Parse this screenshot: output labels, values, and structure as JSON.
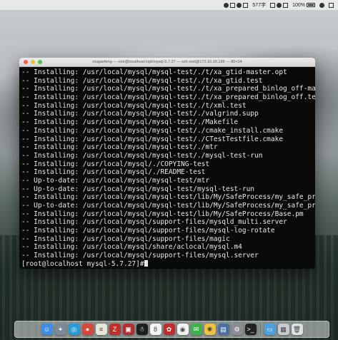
{
  "menubar": {
    "items": [
      "577字",
      "100%"
    ]
  },
  "window": {
    "title": "niugaofeng — root@localhost:/opt/mysql-5.7.27 — ssh root@172.16.20.199 — 80×24"
  },
  "terminal": {
    "lines": [
      "-- Installing: /usr/local/mysql/mysql-test/./t/xa_gtid-master.opt",
      "-- Installing: /usr/local/mysql/mysql-test/./t/xa_gtid.test",
      "-- Installing: /usr/local/mysql/mysql-test/./t/xa_prepared_binlog_off-master.opt",
      "-- Installing: /usr/local/mysql/mysql-test/./t/xa_prepared_binlog_off.test",
      "-- Installing: /usr/local/mysql/mysql-test/./t/xml.test",
      "-- Installing: /usr/local/mysql/mysql-test/./valgrind.supp",
      "-- Installing: /usr/local/mysql/mysql-test/./Makefile",
      "-- Installing: /usr/local/mysql/mysql-test/./cmake_install.cmake",
      "-- Installing: /usr/local/mysql/mysql-test/./CTestTestfile.cmake",
      "-- Installing: /usr/local/mysql/mysql-test/./mtr",
      "-- Installing: /usr/local/mysql/mysql-test/./mysql-test-run",
      "-- Installing: /usr/local/mysql/./COPYING-test",
      "-- Installing: /usr/local/mysql/./README-test",
      "-- Up-to-date: /usr/local/mysql/mysql-test/mtr",
      "-- Up-to-date: /usr/local/mysql/mysql-test/mysql-test-run",
      "-- Installing: /usr/local/mysql/mysql-test/lib/My/SafeProcess/my_safe_process",
      "-- Up-to-date: /usr/local/mysql/mysql-test/lib/My/SafeProcess/my_safe_process",
      "-- Installing: /usr/local/mysql/mysql-test/lib/My/SafeProcess/Base.pm",
      "-- Installing: /usr/local/mysql/support-files/mysqld_multi.server",
      "-- Installing: /usr/local/mysql/support-files/mysql-log-rotate",
      "-- Installing: /usr/local/mysql/support-files/magic",
      "-- Installing: /usr/local/mysql/share/aclocal/mysql.m4",
      "-- Installing: /usr/local/mysql/support-files/mysql.server"
    ],
    "prompt": "[root@localhost mysql-5.7.27]#"
  },
  "dock": {
    "icons": [
      {
        "name": "finder-icon",
        "color": "#3c8fe4",
        "glyph": "☺"
      },
      {
        "name": "launchpad-icon",
        "color": "#7a8899",
        "glyph": "✦"
      },
      {
        "name": "safari-icon",
        "color": "#2a9bd8",
        "glyph": "◎"
      },
      {
        "name": "chrome-icon",
        "color": "#d9463a",
        "glyph": "●"
      },
      {
        "name": "notes-icon",
        "color": "#e8e6d8",
        "glyph": "≡"
      },
      {
        "name": "filezilla-icon",
        "color": "#c0302b",
        "glyph": "Z"
      },
      {
        "name": "navicat-icon",
        "color": "#b03030",
        "glyph": "▣"
      },
      {
        "name": "qq-icon",
        "color": "#1e1e1e",
        "glyph": "☃"
      },
      {
        "name": "calendar-icon",
        "color": "#f4f4f4",
        "glyph": "8"
      },
      {
        "name": "app-icon-red",
        "color": "#c52a2a",
        "glyph": "✿"
      },
      {
        "name": "wechat-icon",
        "color": "#f3f3f3",
        "glyph": "◉"
      },
      {
        "name": "wechat-green-icon",
        "color": "#3fb34a",
        "glyph": "✉"
      },
      {
        "name": "photos-icon",
        "color": "#f0c040",
        "glyph": "✺"
      },
      {
        "name": "preview-icon",
        "color": "#4a6fa0",
        "glyph": "▤"
      },
      {
        "name": "settings-icon",
        "color": "#8a8e93",
        "glyph": "⚙"
      },
      {
        "name": "terminal-icon",
        "color": "#222222",
        "glyph": ">_"
      },
      {
        "name": "folder-icon",
        "color": "#4aa0e0",
        "glyph": "▭"
      },
      {
        "name": "app-icon-gray",
        "color": "#c9ccd0",
        "glyph": "▦"
      },
      {
        "name": "trash-icon",
        "color": "#dfe3e6",
        "glyph": "🗑"
      }
    ]
  }
}
